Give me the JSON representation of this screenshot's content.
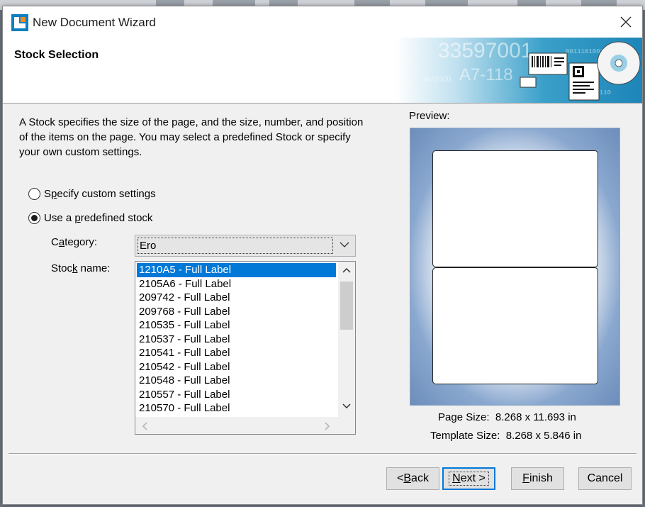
{
  "window": {
    "title": "New Document Wizard"
  },
  "header": {
    "title": "Stock Selection"
  },
  "description": "A Stock specifies the size of the page, and the size, number, and position of the items on the page. You may select a predefined Stock or specify your own custom settings.",
  "options": {
    "custom": {
      "label_pre": "S",
      "label_key": "p",
      "label_post": "ecify custom settings",
      "checked": false
    },
    "predefined": {
      "label_pre": "Use a ",
      "label_key": "p",
      "label_post": "redefined stock",
      "checked": true
    }
  },
  "category": {
    "label_pre": "C",
    "label_key": "a",
    "label_post": "tegory:",
    "value": "Ero"
  },
  "stock_name": {
    "label_pre": "Stoc",
    "label_key": "k",
    "label_post": " name:",
    "items": [
      "1210A5 - Full Label",
      "2105A6 - Full Label",
      "209742 - Full Label",
      "209768 - Full Label",
      "210535 - Full Label",
      "210537 - Full Label",
      "210541 - Full Label",
      "210542 - Full Label",
      "210548 - Full Label",
      "210557 - Full Label",
      "210570 - Full Label"
    ],
    "selected_index": 0
  },
  "preview": {
    "label": "Preview:",
    "page_size_label": "Page Size:",
    "page_size_value": "8.268 x 11.693 in",
    "template_size_label": "Template Size:",
    "template_size_value": "8.268 x 5.846 in"
  },
  "buttons": {
    "back": {
      "pre": "< ",
      "key": "B",
      "post": "ack"
    },
    "next": {
      "pre": "",
      "key": "N",
      "post": "ext >"
    },
    "finish": {
      "pre": "",
      "key": "F",
      "post": "inish"
    },
    "cancel": {
      "label": "Cancel"
    }
  },
  "colors": {
    "accent": "#0078d7",
    "selection": "#0078d7"
  }
}
